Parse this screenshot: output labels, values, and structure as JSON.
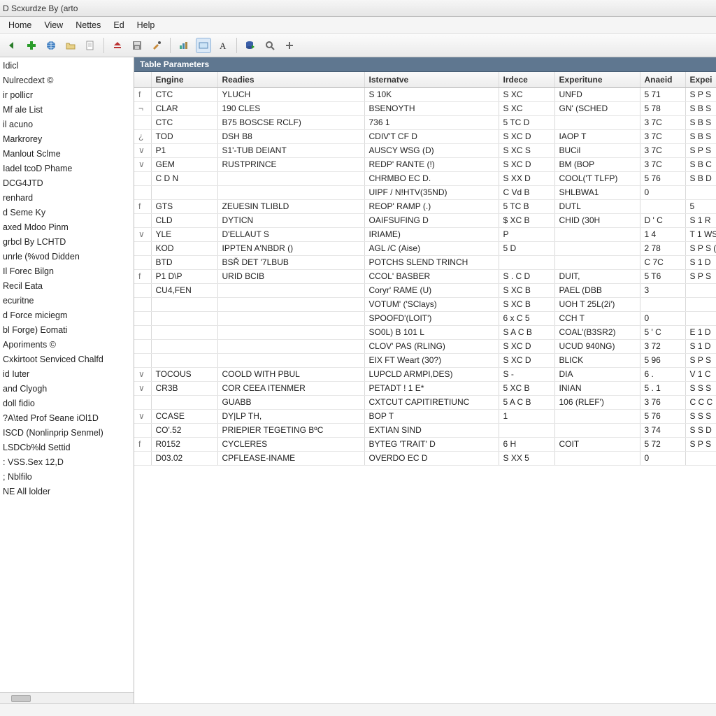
{
  "window": {
    "title": "D Scxurdze By (arto"
  },
  "menu": [
    "Home",
    "View",
    "Nettes",
    "Ed",
    "Help"
  ],
  "toolbar_icons": [
    "back-icon",
    "add-icon",
    "world-icon",
    "folder-icon",
    "page-icon",
    "sep",
    "eject-icon",
    "save-icon",
    "brush-icon",
    "sep",
    "chart-icon",
    "rect-icon",
    "text-a-icon",
    "sep",
    "db-play-icon",
    "search-icon",
    "plus-icon"
  ],
  "sidebar": {
    "items": [
      "Idicl",
      "Nulrecdext ©",
      "ir pollicr",
      "Mf ale List",
      "il acuno",
      "Markrorey",
      "Manlout Sclme",
      "Iadel tcoD Phame",
      "DCG4JTD",
      "renhard",
      "d Seme Ky",
      "axed Mdoo Pinm",
      "grbcl By LCHTD",
      "unrle (%vod Didden",
      "Il Forec Bilgn",
      "Recil Eata",
      "ecuritne",
      "d Force miciegm",
      "bl Forge) Eomati",
      "Aporiments ©",
      "Cxkirtoot Senviced Chalfd",
      "id Iuter",
      "and Clyogh",
      "doll fidio",
      "?A\\ted Prof Seane iOl1D",
      "ISCD (Nonlinprip Senmel)",
      "LSDCb%ld Settid",
      ": VSS.Sex 12,D",
      "; Nblfilo",
      "NE All lolder"
    ]
  },
  "panel": {
    "title": "Table Parameters"
  },
  "grid": {
    "columns": [
      "Engine",
      "Readies",
      "Isternatve",
      "Irdece",
      "Experitune",
      "Anaeid",
      "Expei"
    ],
    "rows": [
      {
        "m": "f",
        "c": [
          "CTC",
          "YLUCH",
          "S 10K",
          "S XC",
          "UNFD",
          "5 71",
          "S P S"
        ]
      },
      {
        "m": "¬",
        "c": [
          "CLAR",
          "190 CLES",
          "BSENOYTH",
          "S XC",
          "GN' (SCHED",
          "5 78",
          "S B S"
        ]
      },
      {
        "m": "",
        "c": [
          "CTC",
          "B75 BOSCSE RCLF)",
          "736 1",
          "5 TC D",
          "",
          "3 7C",
          "S B S"
        ]
      },
      {
        "m": "¿",
        "c": [
          "TOD",
          "DSH B8",
          "CDIV'T CF D",
          "S XC D",
          "IAOP T",
          "3 7C",
          "S B S"
        ]
      },
      {
        "m": "∨",
        "c": [
          "P1",
          "S1'-TUB DEIANT",
          "AUSCY WSG (D)",
          "S XC S",
          "BUCil",
          "3 7C",
          "S P S"
        ]
      },
      {
        "m": "∨",
        "c": [
          "GEM",
          "RUSTPRINCE",
          "REDP' RANTE (!)",
          "S XC D",
          "BM (BOP",
          "3 7C",
          "S B C"
        ]
      },
      {
        "m": "",
        "c": [
          "C D N",
          "",
          "CHRMBO EC D.",
          "S XX D",
          "COOL('T TLFP)",
          "5 76",
          "S B D"
        ]
      },
      {
        "m": "",
        "c": [
          "",
          "",
          "UIPF / N!HTV(35ND)",
          "C Vd B",
          "SHLBWA1",
          "0",
          ""
        ],
        "sep": true
      },
      {
        "m": "f",
        "c": [
          "GTS",
          "ZEUESIN TLIBLD",
          "REOP' RAMP (.)",
          "5 TC B",
          "DUTL",
          "",
          "5"
        ]
      },
      {
        "m": "",
        "c": [
          "CLD",
          "DYTICN",
          "OAIFSUFING D",
          "$ XC B",
          "CHID (30H",
          "D ' C",
          "S 1 R"
        ]
      },
      {
        "m": "∨",
        "c": [
          "YLE",
          "D'ELLAUT S",
          "IRIAME)",
          "P",
          "",
          "1 4",
          "T 1 WS"
        ]
      },
      {
        "m": "",
        "c": [
          "KOD",
          "IPPTEN A'NBDR ()",
          "AGL /C (Aise)",
          "5 D",
          "",
          "2 78",
          "S P S ("
        ]
      },
      {
        "m": "",
        "c": [
          "BTD",
          "BSŘ DET '7LBUB",
          "POTCHS SLEND TRINCH",
          "",
          "",
          "C 7C",
          "S 1 D"
        ]
      },
      {
        "m": "f",
        "c": [
          "P1 D\\P",
          "URID BCIB",
          "CCOL' BASBER",
          "S . C D",
          "DUIT,",
          "5 T6",
          "S P S"
        ],
        "sep": true
      },
      {
        "m": "",
        "c": [
          "CU4,FEN",
          "",
          "Coryr' RAME (U)",
          "S XC B",
          "PAEL (DBB",
          "3",
          ""
        ]
      },
      {
        "m": "",
        "c": [
          "",
          "",
          "VOTUM' ('SClays)",
          "S XC B",
          "UOH T 25L(2i')",
          "",
          ""
        ]
      },
      {
        "m": "",
        "c": [
          "",
          "",
          "SPOOFD'(LOIT')",
          "6 x C 5",
          "CCH T",
          "0",
          ""
        ]
      },
      {
        "m": "",
        "c": [
          "",
          "",
          "SO0L) B  101 L",
          "S A C B",
          "COAL'(B3SR2)",
          "5 ' C",
          "E 1 D"
        ]
      },
      {
        "m": "",
        "c": [
          "",
          "",
          "CLOV' PAS (RLING)",
          "S XC D",
          "UCUD 940NG)",
          "3 72",
          "S 1 D"
        ]
      },
      {
        "m": "",
        "c": [
          "",
          "",
          "EIX FT Weart (30?)",
          "S XC D",
          "BLICK",
          "5 96",
          "S P S"
        ]
      },
      {
        "m": "∨",
        "c": [
          "TOCOUS",
          "COOLD WITH PBUL",
          "LUPCLD ARMPI,DES)",
          "S     -",
          "DIA",
          "6 .",
          "V 1 C"
        ],
        "sep": true
      },
      {
        "m": "∨",
        "c": [
          "CR3B",
          "COR CEEA ITENMER",
          "PETADT ! 1 E*",
          "5 XC B",
          "INIAN",
          "5 . 1",
          "S S S"
        ]
      },
      {
        "m": "",
        "c": [
          "",
          "GUABB",
          "CXTCUT CAPITIRETIUNC",
          "5  A C B",
          "106 (RLEF')",
          "3 76",
          "C C C"
        ]
      },
      {
        "m": "∨",
        "c": [
          "CCASE",
          "DY|LP TH,",
          "BOP T",
          "1",
          "",
          "5 76",
          "S S S"
        ],
        "sep": true
      },
      {
        "m": "",
        "c": [
          "CO'.52",
          "PRIEPIER TEGETING BºC",
          "EXTIAN SIND",
          "",
          "",
          "3 74",
          "S S D"
        ]
      },
      {
        "m": "f",
        "c": [
          "R0152",
          "CYCLERES",
          "BYTEG 'TRAIT' D",
          "6 H",
          "COIT",
          "5 72",
          "S P S"
        ],
        "sep": true
      },
      {
        "m": "",
        "c": [
          "D03.02",
          "CPFLEASE-INAME",
          "OVERDO EC D",
          "S XX 5",
          "",
          "0",
          ""
        ]
      }
    ]
  }
}
